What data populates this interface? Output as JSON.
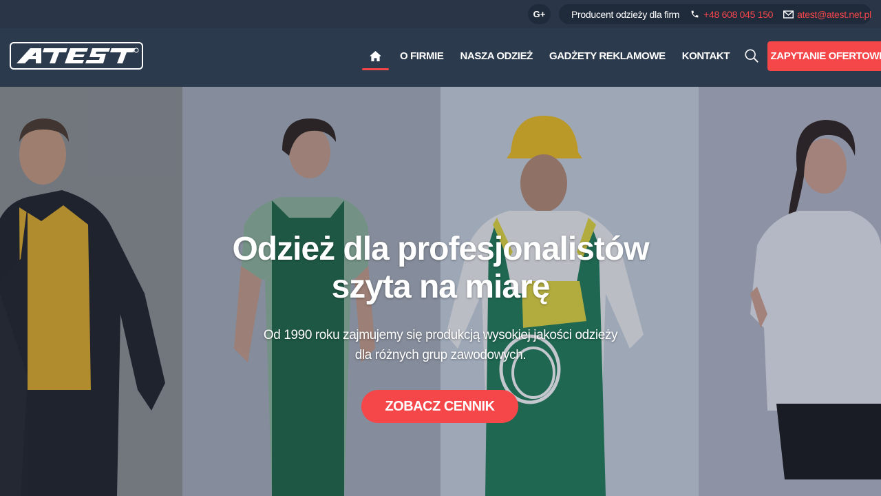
{
  "topbar": {
    "social": {
      "label": "G+",
      "icon": "google-plus-icon"
    },
    "tagline": "Producent odzieży dla firm",
    "phone": {
      "icon": "phone-icon",
      "text": "+48 608 045 150"
    },
    "email": {
      "icon": "envelope-icon",
      "text": "atest@atest.net.pl"
    }
  },
  "nav": {
    "logo": "ATEST",
    "home_icon": "home-icon",
    "items": [
      "O FIRMIE",
      "NASZA ODZIEŻ",
      "GADŻETY REKLAMOWE",
      "KONTAKT"
    ],
    "search_icon": "search-icon",
    "cta": "ZAPYTANIE OFERTOWE"
  },
  "hero": {
    "title": "Odzież dla profesjonalistów\nszyta na miarę",
    "subtitle": "Od 1990 roku zajmujemy się produkcją wysokiej jakości odzieży\ndla różnych grup zawodowych.",
    "cta": "ZOBACZ CENNIK"
  },
  "colors": {
    "accent": "#f5474a",
    "topbar": "#2a3547",
    "navbar": "#2c3a4e",
    "pill": "#1f2a3a"
  }
}
